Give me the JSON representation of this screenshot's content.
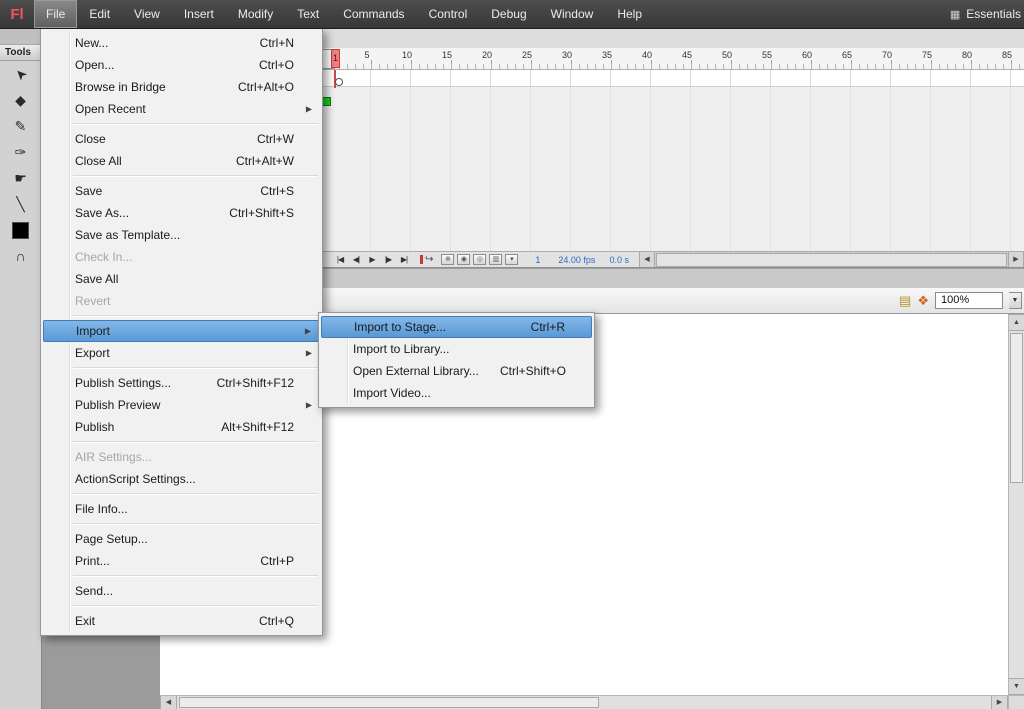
{
  "app": {
    "logo_text": "Fl",
    "workspace_label": "Essentials",
    "workspace_icon": "▦"
  },
  "menubar": {
    "items": [
      "File",
      "Edit",
      "View",
      "Insert",
      "Modify",
      "Text",
      "Commands",
      "Control",
      "Debug",
      "Window",
      "Help"
    ],
    "active_item": "File"
  },
  "file_menu": {
    "items": [
      {
        "label": "New...",
        "shortcut": "Ctrl+N"
      },
      {
        "label": "Open...",
        "shortcut": "Ctrl+O"
      },
      {
        "label": "Browse in Bridge",
        "shortcut": "Ctrl+Alt+O"
      },
      {
        "label": "Open Recent",
        "submenu": true,
        "separator_after": true
      },
      {
        "label": "Close",
        "shortcut": "Ctrl+W"
      },
      {
        "label": "Close All",
        "shortcut": "Ctrl+Alt+W",
        "separator_after": true
      },
      {
        "label": "Save",
        "shortcut": "Ctrl+S"
      },
      {
        "label": "Save As...",
        "shortcut": "Ctrl+Shift+S"
      },
      {
        "label": "Save as Template..."
      },
      {
        "label": "Check In...",
        "disabled": true
      },
      {
        "label": "Save All"
      },
      {
        "label": "Revert",
        "disabled": true,
        "separator_after": true
      },
      {
        "label": "Import",
        "submenu": true,
        "highlighted": true
      },
      {
        "label": "Export",
        "submenu": true,
        "separator_after": true
      },
      {
        "label": "Publish Settings...",
        "shortcut": "Ctrl+Shift+F12"
      },
      {
        "label": "Publish Preview",
        "submenu": true
      },
      {
        "label": "Publish",
        "shortcut": "Alt+Shift+F12",
        "separator_after": true
      },
      {
        "label": "AIR Settings...",
        "disabled": true
      },
      {
        "label": "ActionScript Settings...",
        "separator_after": true
      },
      {
        "label": "File Info...",
        "separator_after": true
      },
      {
        "label": "Page Setup..."
      },
      {
        "label": "Print...",
        "shortcut": "Ctrl+P",
        "separator_after": true
      },
      {
        "label": "Send...",
        "separator_after": true
      },
      {
        "label": "Exit",
        "shortcut": "Ctrl+Q"
      }
    ]
  },
  "import_submenu": {
    "items": [
      {
        "label": "Import to Stage...",
        "shortcut": "Ctrl+R",
        "highlighted": true
      },
      {
        "label": "Import to Library..."
      },
      {
        "label": "Open External Library...",
        "shortcut": "Ctrl+Shift+O"
      },
      {
        "label": "Import Video..."
      }
    ]
  },
  "tools_panel": {
    "title": "Tools",
    "tools": [
      {
        "name": "selection-tool-icon",
        "glyph": "➤"
      },
      {
        "name": "ink-bottle-tool-icon",
        "glyph": "◆"
      },
      {
        "name": "pencil-tool-icon",
        "glyph": "✎"
      },
      {
        "name": "brush-tool-icon",
        "glyph": "✑"
      },
      {
        "name": "hand-tool-icon",
        "glyph": "☛"
      },
      {
        "name": "line-tool-icon",
        "glyph": "╲"
      },
      {
        "name": "fill-color-swatch",
        "swatch": true
      },
      {
        "name": "snap-tool-icon",
        "glyph": "∩"
      }
    ]
  },
  "timeline": {
    "playhead_frame": "1",
    "ruler_numbers": [
      "5",
      "10",
      "15",
      "20",
      "25",
      "30",
      "35",
      "40",
      "45",
      "50",
      "55",
      "60",
      "65",
      "70",
      "75",
      "80",
      "85"
    ],
    "transport_buttons": [
      {
        "name": "go-to-first-frame-button",
        "glyph": "|◀"
      },
      {
        "name": "step-back-button",
        "glyph": "◀|"
      },
      {
        "name": "play-button",
        "glyph": "▶"
      },
      {
        "name": "step-forward-button",
        "glyph": "|▶"
      },
      {
        "name": "go-to-last-frame-button",
        "glyph": "▶|"
      }
    ],
    "loop_icon": "↪",
    "onion_buttons": [
      {
        "name": "center-frame-button",
        "glyph": "⊕"
      },
      {
        "name": "onion-skin-button",
        "glyph": "◉"
      },
      {
        "name": "onion-skin-outlines-button",
        "glyph": "◎"
      },
      {
        "name": "edit-multiple-frames-button",
        "glyph": "▥"
      },
      {
        "name": "modify-markers-button",
        "glyph": "▾"
      }
    ],
    "current_frame": "1",
    "frame_rate": "24.00 fps",
    "elapsed_time": "0.0 s"
  },
  "edit_bar": {
    "icons": [
      {
        "name": "edit-scene-button",
        "glyph": "▤"
      },
      {
        "name": "edit-symbols-button",
        "glyph": "❖"
      }
    ],
    "zoom_value": "100%"
  },
  "icons": {
    "left_arrow": "◀",
    "right_arrow": "▶",
    "up_arrow": "▲",
    "down_arrow": "▼"
  },
  "colors": {
    "menubar_bg": "#3f3f3f",
    "menu_highlight_blue": "#5a99d6",
    "playhead_red": "#d64545",
    "hot_text_blue": "#2a6bc0",
    "layer_green": "#1ecb1e"
  }
}
